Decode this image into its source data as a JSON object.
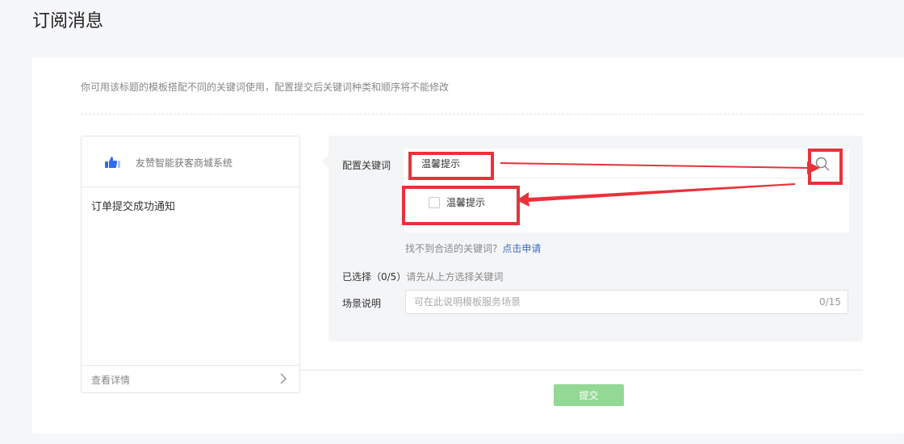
{
  "page": {
    "title": "订阅消息"
  },
  "tip": "你可用该标题的模板搭配不同的关键词使用，配置提交后关键词种类和顺序将不能修改",
  "preview": {
    "app_name": "友赞智能获客商城系统",
    "message_title": "订单提交成功通知",
    "detail_link": "查看详情"
  },
  "form": {
    "keyword_label": "配置关键词",
    "keyword_value": "温馨提示",
    "option_label": "温馨提示",
    "not_found_text": "找不到合适的关键词?",
    "apply_link": "点击申请",
    "selected_label": "已选择（0/5）",
    "selected_hint": "请先从上方选择关键词",
    "scene_label": "场景说明",
    "scene_placeholder": "可在此说明模板服务场景",
    "scene_counter": "0/15"
  },
  "actions": {
    "submit_label": "提交"
  },
  "colors": {
    "accent_green": "#94d895",
    "link_blue": "#3b6cc5",
    "annotation_red": "#e8323a",
    "logo_blue": "#2f6bed"
  },
  "icons": {
    "logo": "thumbs-up-icon",
    "search": "search-icon",
    "chevron": "chevron-right-icon"
  }
}
